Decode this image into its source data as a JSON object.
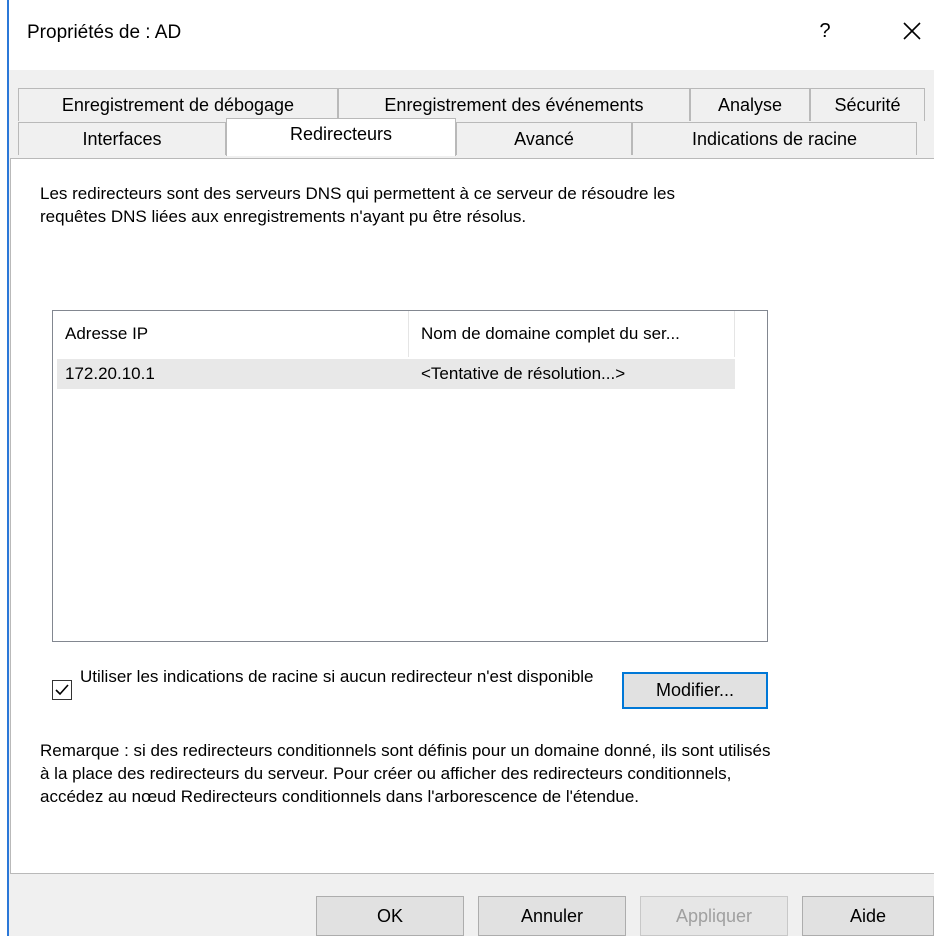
{
  "window": {
    "title": "Propriétés de : AD",
    "help_label": "?"
  },
  "tabs": {
    "row1": [
      "Enregistrement de débogage",
      "Enregistrement des événements",
      "Analyse",
      "Sécurité"
    ],
    "row2": [
      "Interfaces",
      "Redirecteurs",
      "Avancé",
      "Indications de racine"
    ],
    "active": "Redirecteurs"
  },
  "panel": {
    "description": "Les redirecteurs sont des serveurs DNS qui permettent à ce serveur de résoudre les requêtes DNS liées aux enregistrements n'ayant pu être résolus.",
    "list": {
      "columns": [
        "Adresse IP",
        "Nom de domaine complet du ser..."
      ],
      "rows": [
        {
          "ip": "172.20.10.1",
          "fqdn": "<Tentative de résolution...>"
        }
      ]
    },
    "use_root_hints": {
      "checked": true,
      "label": "Utiliser les indications de racine si aucun redirecteur n'est disponible"
    },
    "modify_button": "Modifier...",
    "note": "Remarque : si des redirecteurs conditionnels sont définis pour un domaine donné, ils sont utilisés à la place des redirecteurs du serveur. Pour créer ou afficher des redirecteurs conditionnels, accédez au nœud Redirecteurs conditionnels dans l'arborescence de l'étendue."
  },
  "footer": {
    "ok": "OK",
    "cancel": "Annuler",
    "apply": "Appliquer",
    "help": "Aide"
  },
  "colors": {
    "accent": "#0078d7",
    "window_edge": "#2b78d8",
    "dialog_bg": "#f0f0f0",
    "selected_row": "#e8e8e8"
  },
  "icons": {
    "close": "close-icon",
    "checkbox": "checkmark-icon"
  }
}
